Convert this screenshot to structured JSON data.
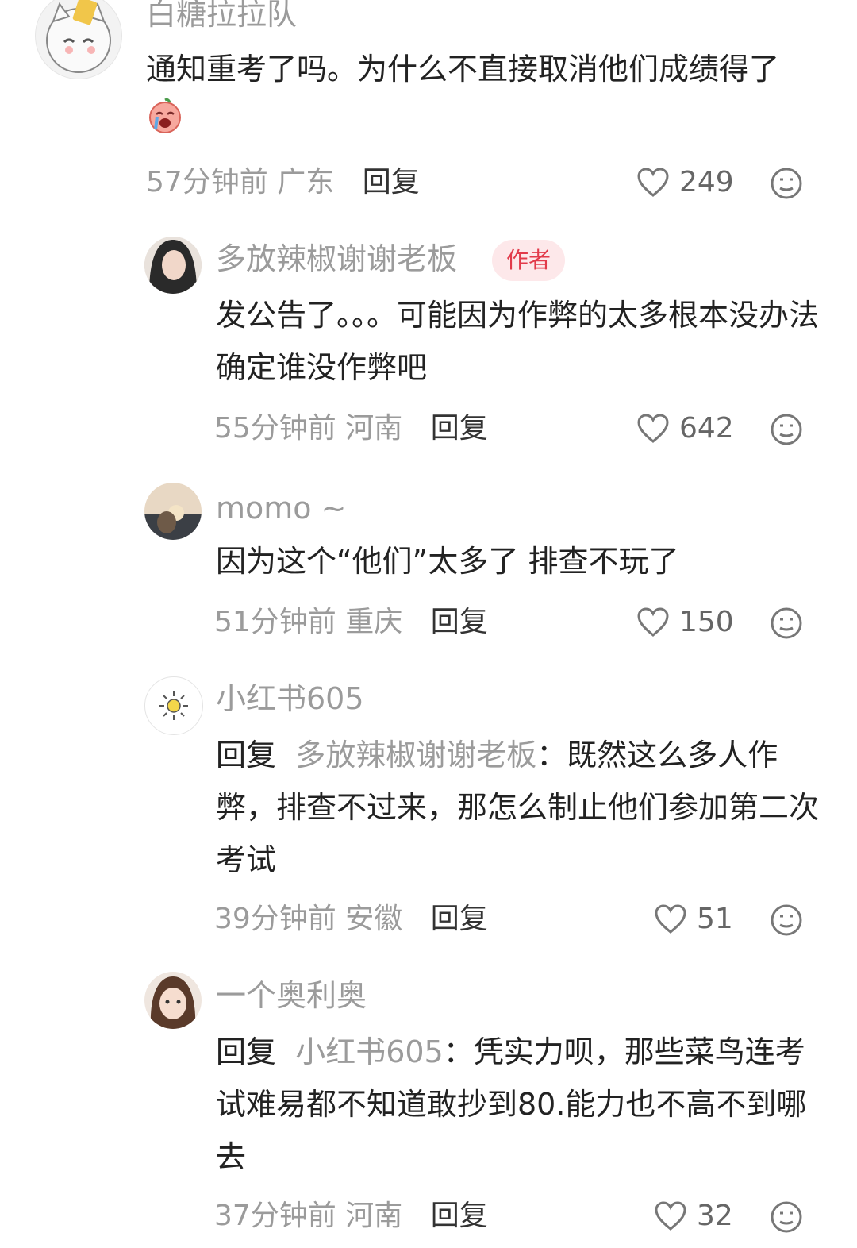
{
  "comments": [
    {
      "username": "白糖拉拉队",
      "text": "通知重考了吗。为什么不直接取消他们成绩得了",
      "time": "57分钟前",
      "location": "广东",
      "reply_label": "回复",
      "likes": "249"
    },
    {
      "username": "多放辣椒谢谢老板",
      "badge": "作者",
      "text": "发公告了。。。可能因为作弊的太多根本没办法确定谁没作弊吧",
      "time": "55分钟前",
      "location": "河南",
      "reply_label": "回复",
      "likes": "642"
    },
    {
      "username": "momo ~",
      "text": "因为这个“他们”太多了 排查不玩了",
      "time": "51分钟前",
      "location": "重庆",
      "reply_label": "回复",
      "likes": "150"
    },
    {
      "username": "小红书605",
      "reply_prefix": "回复",
      "mention": "多放辣椒谢谢老板",
      "text": "：既然这么多人作弊，排查不过来，那怎么制止他们参加第二次考试",
      "time": "39分钟前",
      "location": "安徽",
      "reply_label": "回复",
      "likes": "51"
    },
    {
      "username": "一个奥利奥",
      "reply_prefix": "回复",
      "mention": "小红书605",
      "text": "：凭实力呗，那些菜鸟连考试难易都不知道敢抄到80.能力也不高不到哪去",
      "time": "37分钟前",
      "location": "河南",
      "reply_label": "回复",
      "likes": "32"
    }
  ],
  "icons": {
    "like": "heart-outline-icon",
    "more": "emoji-face-icon",
    "crying": "crying-emoji-icon"
  },
  "colors": {
    "author_badge_text": "#e23a4a",
    "author_badge_bg": "#fde8ea",
    "muted": "#9b9b9b"
  }
}
